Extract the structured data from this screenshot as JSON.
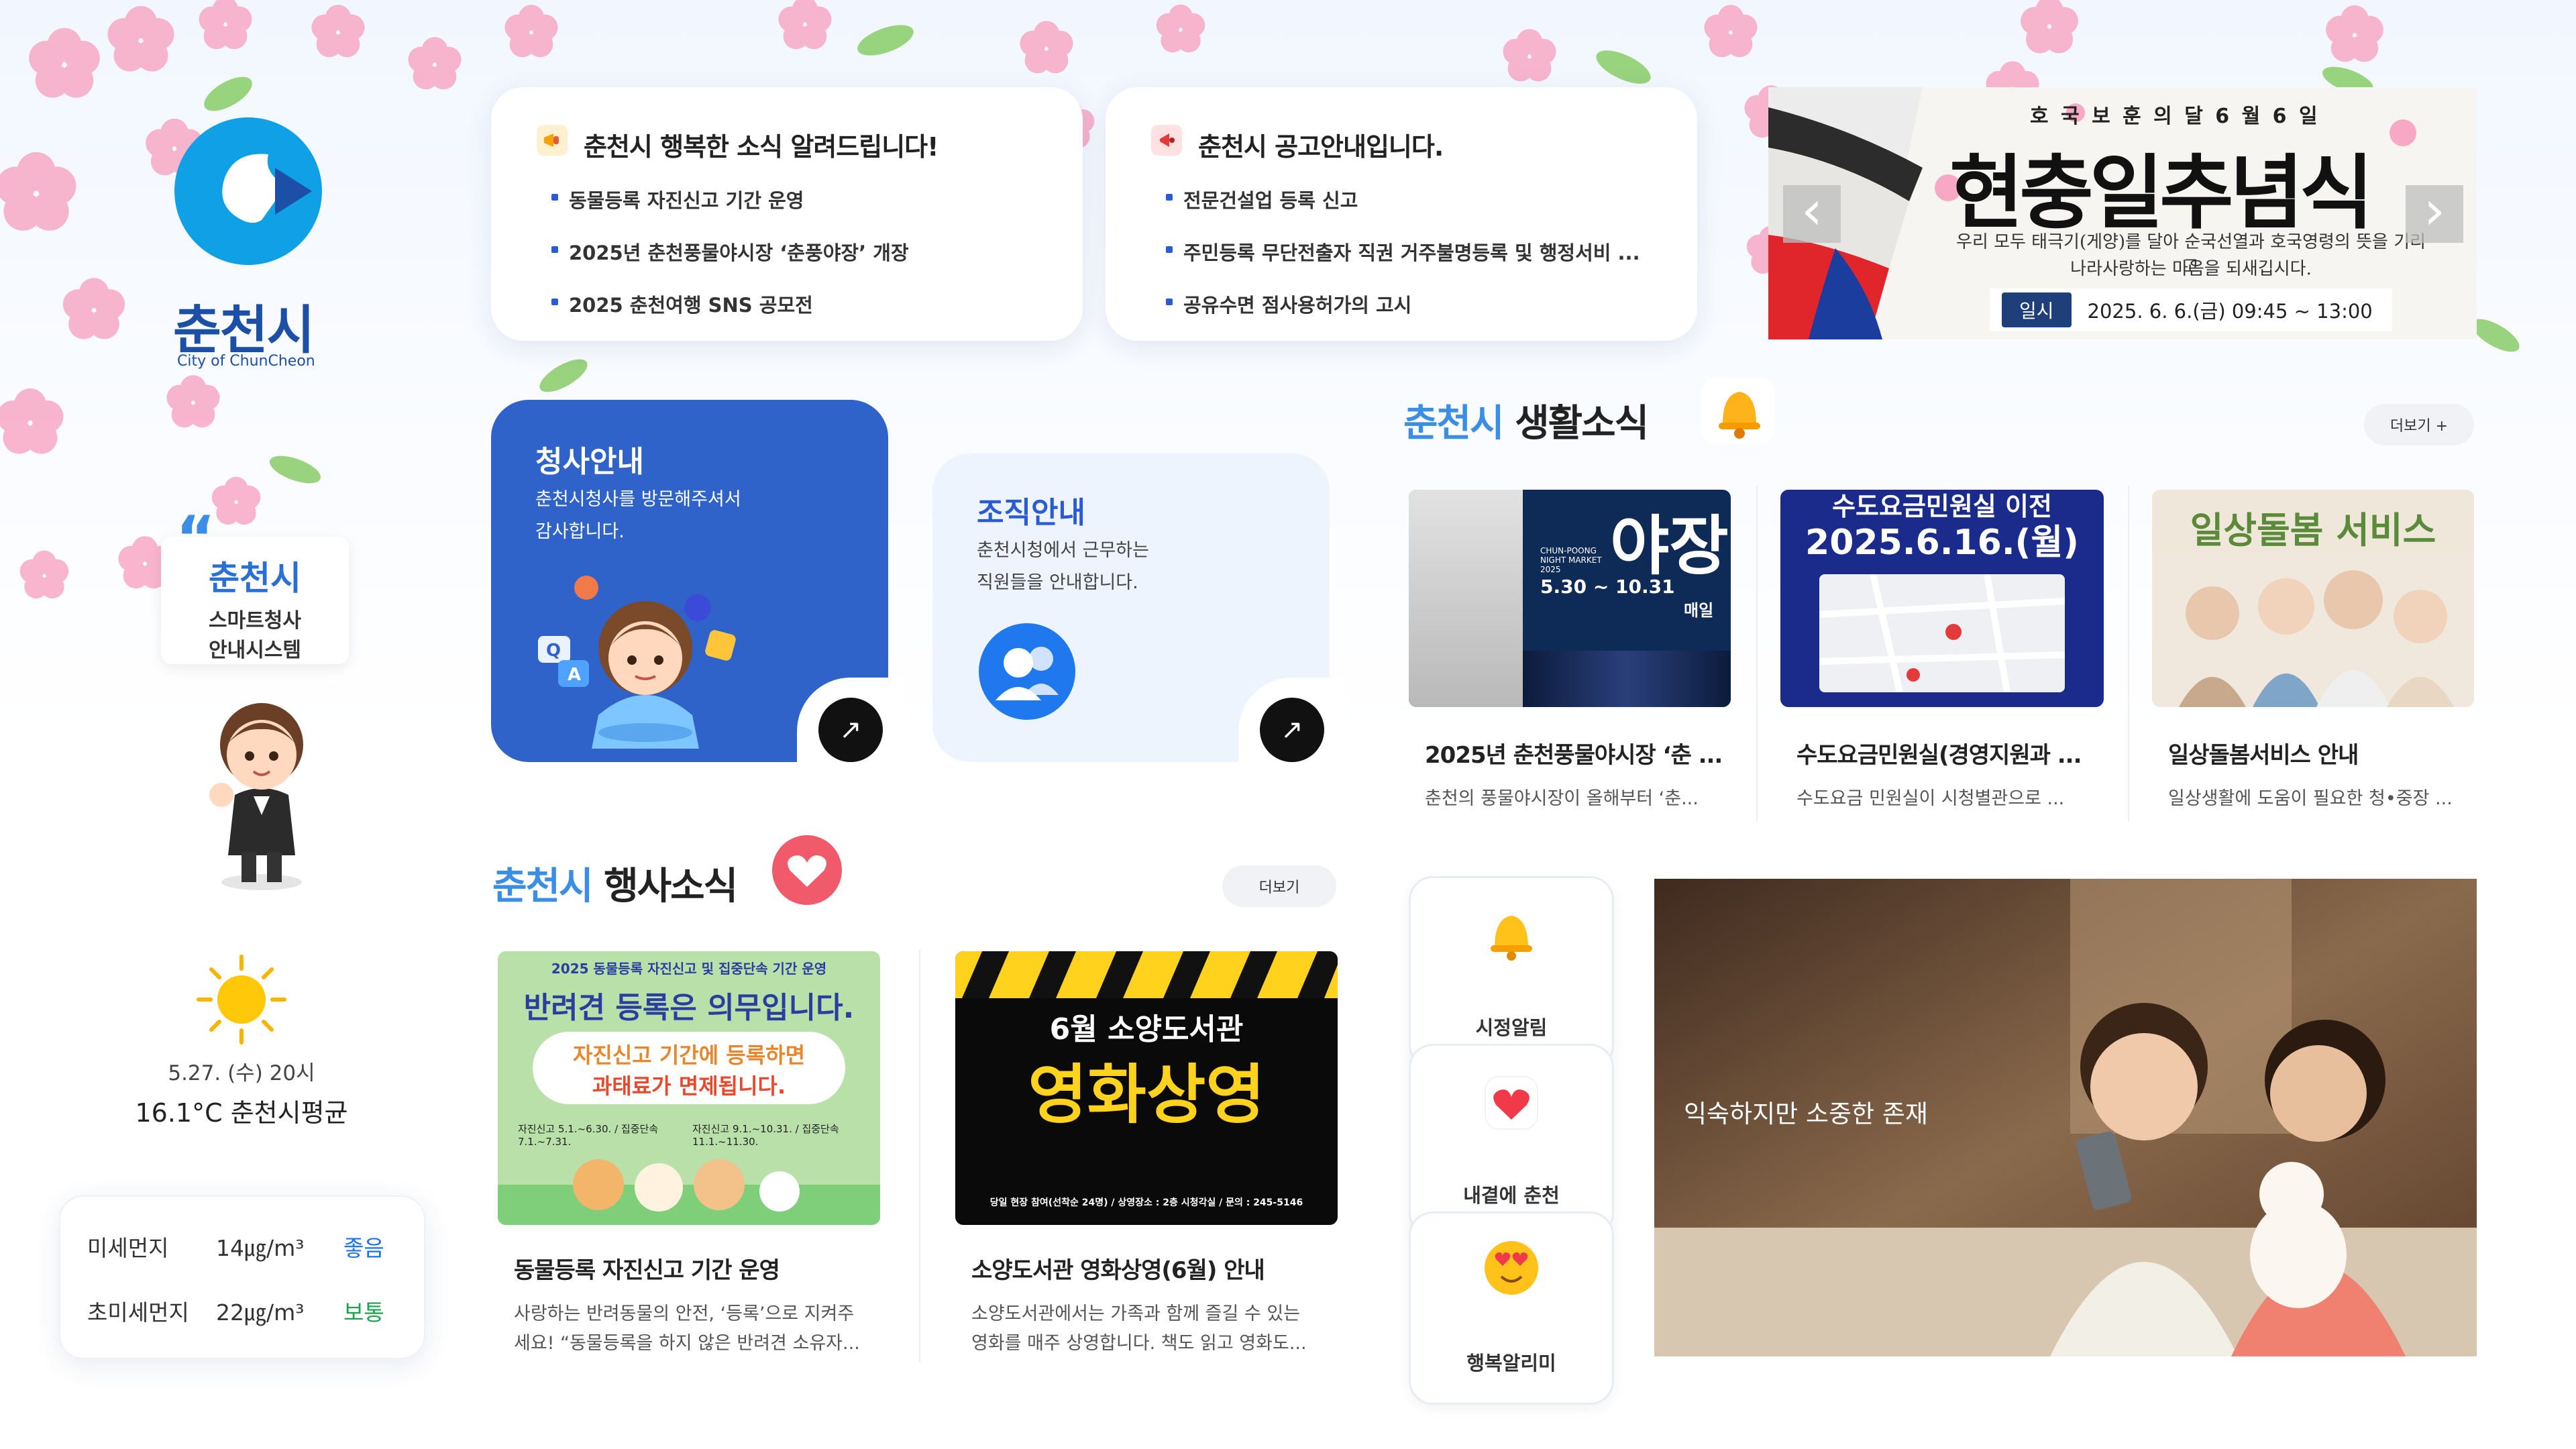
{
  "logo": {
    "name": "춘천시",
    "sub": "City of ChunCheon"
  },
  "guide": {
    "quote": "“",
    "title": "춘천시",
    "line1": "스마트청사",
    "line2": "안내시스템"
  },
  "weather": {
    "icon": "sun-icon",
    "datetime": "5.27. (수) 20시",
    "temp": "16.1°C 춘천시평균",
    "dust": [
      {
        "label": "미세먼지",
        "value": "14㎍/m³",
        "status": "좋음",
        "color": "#1a73e8"
      },
      {
        "label": "초미세먼지",
        "value": "22㎍/m³",
        "status": "보통",
        "color": "#1aa34a"
      }
    ]
  },
  "notice1": {
    "icon": "megaphone-icon",
    "title": "춘천시 행복한 소식 알려드립니다!",
    "items": [
      "동물등록 자진신고 기간 운영",
      "2025년 춘천풍물야시장 ‘춘풍야장’ 개장",
      "2025 춘천여행 SNS 공모전"
    ]
  },
  "notice2": {
    "icon": "notice-icon",
    "title": "춘천시 공고안내입니다.",
    "items": [
      "전문건설업 등록 신고",
      "주민등록 무단전출자 직권 거주불명등록 및 행정서비 ...",
      "공유수면 점사용허가의 고시"
    ]
  },
  "banner": {
    "top": "호 국 보 훈 의 달 6 월 6 일",
    "title": "현충일추념식",
    "desc1": "우리 모두 태극기(게양)를 달아 순국선열과 호국영령의 뜻을 기리고",
    "desc2": "나라사랑하는 마음을 되새깁시다.",
    "date_label": "일시",
    "date": "2025. 6. 6.(금) 09:45 ~ 13:00",
    "prev": "‹",
    "next": "›"
  },
  "office": {
    "title": "청사안내",
    "desc1": "춘천시청사를 방문해주셔서",
    "desc2": "감사합니다.",
    "arrow": "↗"
  },
  "org": {
    "title": "조직안내",
    "desc1": "춘천시청에서 근무하는",
    "desc2": "직원들을 안내합니다.",
    "arrow": "↗"
  },
  "life": {
    "title_hl": "춘천시",
    "title": "생활소식",
    "more": "더보기 +",
    "items": [
      {
        "title": "2025년 춘천풍물야시장 ‘춘 ...",
        "desc": "춘천의 풍물야시장이 올해부터 ‘춘...",
        "thumb": {
          "word": "야장",
          "sub": "CHUN-POONG NIGHT MARKET 2025",
          "date": "5.30 ~ 10.31",
          "tag": "매일"
        }
      },
      {
        "title": "수도요금민원실(경영지원과 ...",
        "desc": "수도요금 민원실이 시청별관으로 ...",
        "thumb": {
          "top": "수도요금민원실 이전",
          "date": "2025.6.16.(월)"
        }
      },
      {
        "title": "일상돌봄서비스 안내",
        "desc": "일상생활에 도움이 필요한 청•중장 ...",
        "thumb": {
          "title": "일상돌봄 서비스"
        }
      }
    ]
  },
  "events": {
    "title_hl": "춘천시",
    "title": "행사소식",
    "more": "더보기",
    "items": [
      {
        "title": "동물등록 자진신고 기간 운영",
        "desc1": "사랑하는 반려동물의 안전, ‘등록’으로 지켜주",
        "desc2": "세요! “동물등록을 하지 않은 반려견 소유자...",
        "poster": {
          "top": "2025 동물등록 자진신고 및 집중단속 기간 운영",
          "head": "반려견 등록은 의무입니다.",
          "quote1": "자진신고 기간에 등록하면",
          "quote2": "과태료가 면제됩니다.",
          "period1": "자진신고 5.1.~6.30. / 집중단속 7.1.~7.31.",
          "period2": "자진신고 9.1.~10.31. / 집중단속 11.1.~11.30."
        }
      },
      {
        "title": "소양도서관 영화상영(6월) 안내",
        "desc1": "소양도서관에서는 가족과 함께 즐길 수 있는",
        "desc2": "영화를 매주 상영합니다. 책도 읽고 영화도...",
        "poster": {
          "sub": "6월 소양도서관",
          "head": "영화상영",
          "foot": "당일 현장 참여(선착순 24명) / 상영장소 : 2층 시청각실 / 문의 : 245-5146"
        }
      }
    ]
  },
  "quick": [
    {
      "label": "시정알림",
      "icon": "bell-icon"
    },
    {
      "label": "내곁에 춘천",
      "icon": "heart-icon"
    },
    {
      "label": "행복알리미",
      "icon": "smile-love-icon"
    }
  ],
  "video": {
    "caption": "익숙하지만 소중한 존재"
  }
}
